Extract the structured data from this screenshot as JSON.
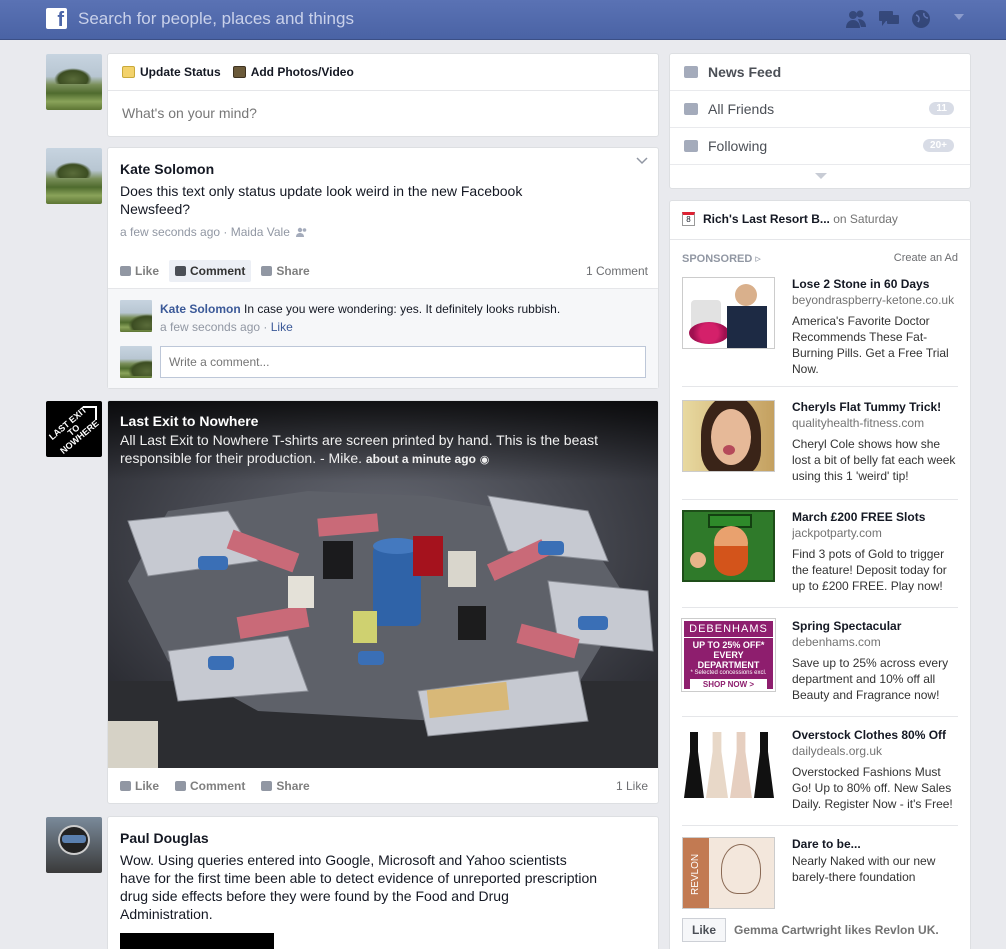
{
  "topbar": {
    "logo": "f",
    "search_placeholder": "Search for people, places and things",
    "icons": [
      "friends-icon",
      "messages-icon",
      "globe-icon",
      "chevron-down-icon"
    ]
  },
  "composer": {
    "update_status": "Update Status",
    "add_photos": "Add Photos/Video",
    "placeholder": "What's on your mind?"
  },
  "post1": {
    "author": "Kate Solomon",
    "text": "Does this text only status update look weird in the new Facebook Newsfeed?",
    "meta": "a few seconds ago · Maida Vale",
    "like": "Like",
    "comment": "Comment",
    "share": "Share",
    "comment_count": "1 Comment",
    "comment_author": "Kate Solomon",
    "comment_text": "In case you were wondering: yes. It definitely looks rubbish.",
    "comment_meta": "a few seconds ago · ",
    "comment_like": "Like",
    "write_placeholder": "Write a comment..."
  },
  "post2": {
    "author": "Last Exit to Nowhere",
    "logo_text": "LAST EXIT TO NOWHERE",
    "text": "All Last Exit to Nowhere T-shirts are screen printed by hand. This is the beast responsible for their production. - Mike.",
    "time": "about a minute ago",
    "like": "Like",
    "comment": "Comment",
    "share": "Share",
    "like_count": "1 Like"
  },
  "post3": {
    "author": "Paul Douglas",
    "text": "Wow. Using queries entered into Google, Microsoft and Yahoo scientists have for the first time been able to detect evidence of unreported prescription drug side effects before they were found by the Food and Drug Administration."
  },
  "sidebar": {
    "news_feed": "News Feed",
    "all_friends": "All Friends",
    "all_friends_count": "11",
    "following": "Following",
    "following_count": "20+",
    "event_title": "Rich's Last Resort B...",
    "event_when": " on Saturday",
    "sponsored": "SPONSORED",
    "create_ad": "Create an Ad",
    "ads": [
      {
        "title": "Lose 2 Stone in 60 Days",
        "domain": "beyondraspberry-ketone.co.uk",
        "desc": "America's Favorite Doctor Recommends These Fat-Burning Pills. Get a Free Trial Now."
      },
      {
        "title": "Cheryls Flat Tummy Trick!",
        "domain": "qualityhealth-fitness.com",
        "desc": "Cheryl Cole shows how she lost a bit of belly fat each week using this 1 'weird' tip!"
      },
      {
        "title": "March £200 FREE Slots",
        "domain": "jackpotparty.com",
        "desc": "Find 3 pots of Gold to trigger the feature! Deposit today for up to £200 FREE. Play now!"
      },
      {
        "title": "Spring Spectacular",
        "domain": "debenhams.com",
        "desc": "Save up to 25% across every department and 10% off all Beauty and Fragrance now!"
      },
      {
        "title": "Overstock Clothes 80% Off",
        "domain": "dailydeals.org.uk",
        "desc": "Overstocked Fashions Must Go! Up to 80% off. New Sales Daily. Register Now - it's Free!"
      },
      {
        "title": "Dare to be...",
        "domain": "",
        "desc": "Nearly Naked with our new barely-there foundation"
      }
    ],
    "debenhams": {
      "brand": "DEBENHAMS",
      "line1": "UP TO 25% OFF*",
      "line2": "EVERY DEPARTMENT",
      "line3": "* Selected concessions excl.",
      "cta": "SHOP NOW >"
    },
    "revlon_brand": "REVLON",
    "like_button": "Like",
    "social": "Gemma Cartwright likes Revlon UK."
  }
}
